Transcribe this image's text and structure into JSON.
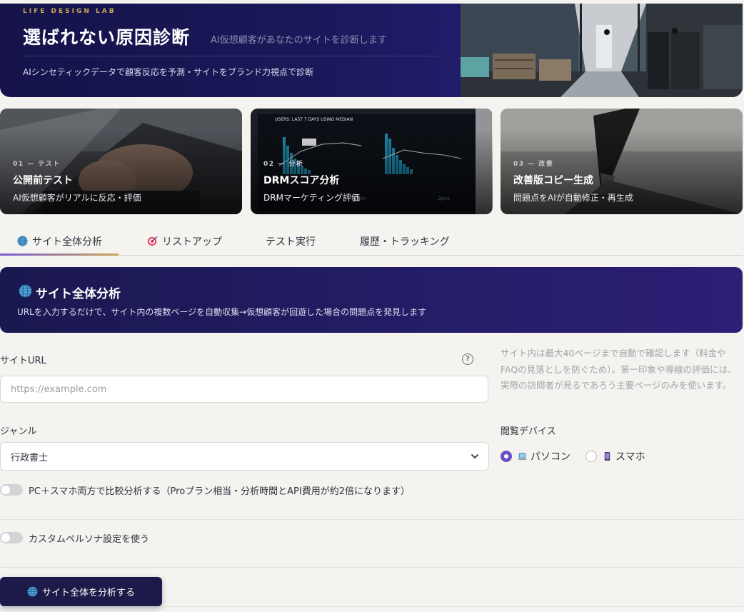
{
  "hero": {
    "eyebrow": "LIFE DESIGN LAB",
    "title": "選ばれない原因診断",
    "subtitle": "AI仮想顧客があなたのサイトを診断します",
    "description": "AIシンセティックデータで顧客反応を予測・サイトをブランド力視点で診断"
  },
  "cards": [
    {
      "num": "01 — テスト",
      "title": "公開前テスト",
      "desc": "AI仮想顧客がリアルに反応・評価"
    },
    {
      "num": "02 — 分析",
      "title": "DRMスコア分析",
      "desc": "DRMマーケティング評価"
    },
    {
      "num": "03 — 改善",
      "title": "改善版コピー生成",
      "desc": "問題点をAIが自動修正・再生成"
    }
  ],
  "tabs": [
    {
      "label": "サイト全体分析",
      "icon": "globe-icon",
      "active": true
    },
    {
      "label": "リストアップ",
      "icon": "target-icon",
      "active": false
    },
    {
      "label": "テスト実行",
      "icon": "",
      "active": false
    },
    {
      "label": "履歴・トラッキング",
      "icon": "",
      "active": false
    }
  ],
  "banner": {
    "title": "サイト全体分析",
    "description": "URLを入力するだけで、サイト内の複数ページを自動収集→仮想顧客が回遊した場合の問題点を発見します"
  },
  "form": {
    "url_label": "サイトURL",
    "url_placeholder": "https://example.com",
    "url_value": "",
    "note": "サイト内は最大40ページまで自動で確認します（料金やFAQの見落としを防ぐため）。第一印象や導線の評価には、実際の訪問者が見るであろう主要ページのみを使います。",
    "genre_label": "ジャンル",
    "genre_value": "行政書士",
    "device_label": "閲覧デバイス",
    "device_options": [
      {
        "label": "パソコン",
        "icon": "laptop-icon",
        "selected": true
      },
      {
        "label": "スマホ",
        "icon": "smartphone-icon",
        "selected": false
      }
    ],
    "compare_toggle_label": "PC＋スマホ両方で比較分析する（Proプラン相当・分析時間とAPI費用が約2倍になります）",
    "compare_toggle_on": false,
    "persona_toggle_label": "カスタムペルソナ設定を使う",
    "persona_toggle_on": false,
    "submit_label": "サイト全体を分析する"
  },
  "colors": {
    "navy": "#1a1858",
    "accent_purple": "#6b4fc7",
    "accent_gold": "#c9a558",
    "page_bg": "#f4f3f0"
  }
}
